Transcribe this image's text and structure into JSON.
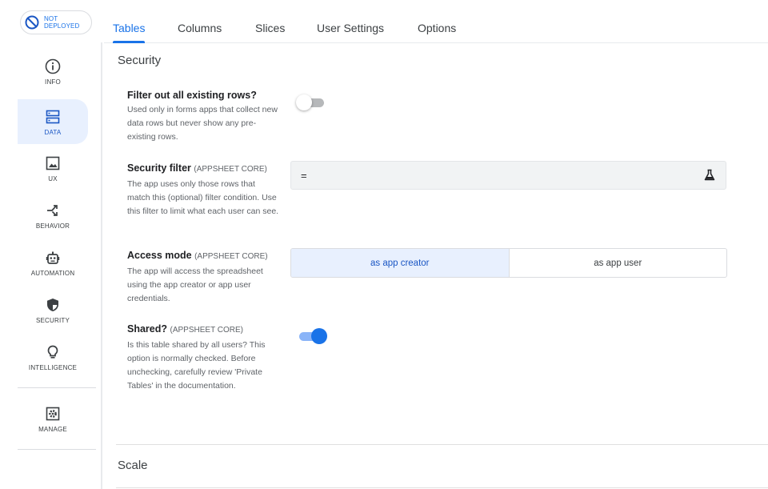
{
  "deploy_badge": {
    "label": "NOT DEPLOYED",
    "icon": "not-deployed-icon"
  },
  "tabs": [
    {
      "label": "Tables",
      "active": true
    },
    {
      "label": "Columns"
    },
    {
      "label": "Slices"
    },
    {
      "label": "User Settings"
    },
    {
      "label": "Options"
    }
  ],
  "sidebar": {
    "items": [
      {
        "label": "INFO",
        "icon": "info-icon"
      },
      {
        "label": "DATA",
        "icon": "data-icon",
        "active": true
      },
      {
        "label": "UX",
        "icon": "image-icon"
      },
      {
        "label": "BEHAVIOR",
        "icon": "shuffle-icon"
      },
      {
        "label": "AUTOMATION",
        "icon": "robot-icon"
      },
      {
        "label": "SECURITY",
        "icon": "shield-icon"
      },
      {
        "label": "INTELLIGENCE",
        "icon": "lightbulb-icon"
      },
      {
        "label": "MANAGE",
        "icon": "manage-gear-icon"
      }
    ]
  },
  "security": {
    "title": "Security",
    "filter_rows": {
      "title": "Filter out all existing rows?",
      "description": "Used only in forms apps that collect new data rows but never show any pre-existing rows.",
      "enabled": false
    },
    "security_filter": {
      "title": "Security filter",
      "tag": "(APPSHEET CORE)",
      "description": "The app uses only those rows that match this (optional) filter condition. Use this filter to limit what each user can see.",
      "value": "="
    },
    "access_mode": {
      "title": "Access mode",
      "tag": "(APPSHEET CORE)",
      "description": "The app will access the spreadsheet using the app creator or app user credentials.",
      "options": [
        "as app creator",
        "as app user"
      ],
      "selected": "as app creator"
    },
    "shared": {
      "title": "Shared?",
      "tag": "(APPSHEET CORE)",
      "description": "Is this table shared by all users? This option is normally checked. Before unchecking, carefully review 'Private Tables' in the documentation.",
      "enabled": true
    }
  },
  "scale": {
    "title": "Scale"
  },
  "colors": {
    "accent": "#1a73e8",
    "active_bg": "#e8f0fe",
    "toggle_off": "#b6b8ba"
  }
}
